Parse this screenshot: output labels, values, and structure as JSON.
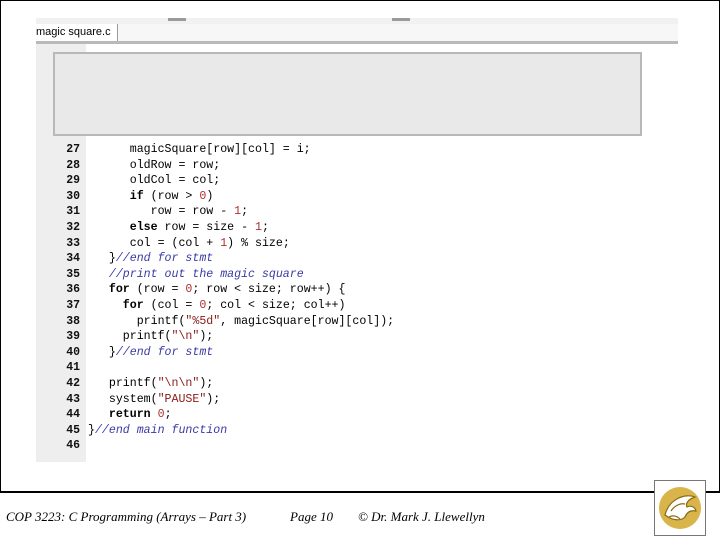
{
  "editor": {
    "tab_label": "magic square.c",
    "lines": [
      {
        "n": "27",
        "parts": [
          [
            "      ",
            ""
          ],
          [
            "magicSquare[row][col] = i;",
            ""
          ]
        ]
      },
      {
        "n": "28",
        "parts": [
          [
            "      oldRow = row;",
            ""
          ]
        ]
      },
      {
        "n": "29",
        "parts": [
          [
            "      oldCol = col;",
            ""
          ]
        ]
      },
      {
        "n": "30",
        "parts": [
          [
            "      ",
            ""
          ],
          [
            "if",
            "kw"
          ],
          [
            " (row > ",
            ""
          ],
          [
            "0",
            "nm"
          ],
          [
            ")",
            ""
          ]
        ]
      },
      {
        "n": "31",
        "parts": [
          [
            "         row = row - ",
            ""
          ],
          [
            "1",
            "nm"
          ],
          [
            ";",
            ""
          ]
        ]
      },
      {
        "n": "32",
        "parts": [
          [
            "      ",
            ""
          ],
          [
            "else",
            "kw"
          ],
          [
            " row = size - ",
            ""
          ],
          [
            "1",
            "nm"
          ],
          [
            ";",
            ""
          ]
        ]
      },
      {
        "n": "33",
        "parts": [
          [
            "      col = (col + ",
            ""
          ],
          [
            "1",
            "nm"
          ],
          [
            ") % size;",
            ""
          ]
        ]
      },
      {
        "n": "34",
        "parts": [
          [
            "   }",
            ""
          ],
          [
            "//end for stmt",
            "cm"
          ]
        ]
      },
      {
        "n": "35",
        "parts": [
          [
            "   ",
            ""
          ],
          [
            "//print out the magic square",
            "cm"
          ]
        ]
      },
      {
        "n": "36",
        "parts": [
          [
            "   ",
            ""
          ],
          [
            "for",
            "kw"
          ],
          [
            " (row = ",
            ""
          ],
          [
            "0",
            "nm"
          ],
          [
            "; row < size; row++) {",
            ""
          ]
        ]
      },
      {
        "n": "37",
        "parts": [
          [
            "     ",
            ""
          ],
          [
            "for",
            "kw"
          ],
          [
            " (col = ",
            ""
          ],
          [
            "0",
            "nm"
          ],
          [
            "; col < size; col++)",
            ""
          ]
        ]
      },
      {
        "n": "38",
        "parts": [
          [
            "       printf(",
            ""
          ],
          [
            "\"%5d\"",
            "st"
          ],
          [
            ", magicSquare[row][col]);",
            ""
          ]
        ]
      },
      {
        "n": "39",
        "parts": [
          [
            "     printf(",
            ""
          ],
          [
            "\"\\n\"",
            "st"
          ],
          [
            ");",
            ""
          ]
        ]
      },
      {
        "n": "40",
        "parts": [
          [
            "   }",
            ""
          ],
          [
            "//end for stmt",
            "cm"
          ]
        ]
      },
      {
        "n": "41",
        "parts": [
          [
            "",
            ""
          ]
        ]
      },
      {
        "n": "42",
        "parts": [
          [
            "   printf(",
            ""
          ],
          [
            "\"\\n\\n\"",
            "st"
          ],
          [
            ");",
            ""
          ]
        ]
      },
      {
        "n": "43",
        "parts": [
          [
            "   system(",
            ""
          ],
          [
            "\"PAUSE\"",
            "st"
          ],
          [
            ");",
            ""
          ]
        ]
      },
      {
        "n": "44",
        "parts": [
          [
            "   ",
            ""
          ],
          [
            "return",
            "kw"
          ],
          [
            " ",
            ""
          ],
          [
            "0",
            "nm"
          ],
          [
            ";",
            ""
          ]
        ]
      },
      {
        "n": "45",
        "parts": [
          [
            "}",
            ""
          ],
          [
            "//end main function",
            "cm"
          ]
        ]
      },
      {
        "n": "46",
        "parts": [
          [
            "",
            ""
          ]
        ]
      }
    ],
    "clipped_top_line_number": "21"
  },
  "footer": {
    "course": "COP 3223: C Programming (Arrays – Part 3)",
    "page": "Page 10",
    "author": "© Dr. Mark J. Llewellyn"
  },
  "colors": {
    "keyword": "#000000",
    "comment": "#3a3aa6",
    "string": "#8a1a1a",
    "number": "#b03030",
    "gutter": "#eeeeee",
    "overlay": "#e9e9e9"
  },
  "icons": {
    "logo": "pegasus-logo-icon"
  }
}
